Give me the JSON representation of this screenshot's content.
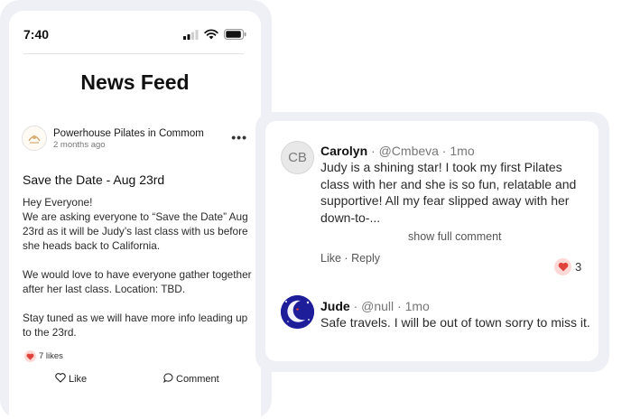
{
  "status_bar": {
    "time": "7:40"
  },
  "feed": {
    "title": "News Feed",
    "post": {
      "author": "Powerhouse Pilates in Commom",
      "time_ago": "2 months ago",
      "title": "Save the Date - Aug 23rd",
      "paragraphs": [
        "Hey Everyone!\nWe are asking everyone to “Save the Date” Aug 23rd as it will be Judy’s last class with us before she heads back to California.",
        "We would love to have everyone gather together after her last class. Location: TBD.",
        "Stay tuned as we will have more info leading up to the 23rd."
      ],
      "likes": "7 likes",
      "like_label": "Like",
      "comment_label": "Comment"
    }
  },
  "comments": [
    {
      "initials": "CB",
      "name": "Carolyn",
      "handle": "@Cmbeva",
      "time": "1mo",
      "text": "Judy is a shining star! I took my first Pilates class with her and she is so fun, relatable and supportive! All my fear slipped away with her down-to-...",
      "show_full": "show full comment",
      "like_label": "Like",
      "reply_label": "Reply",
      "reaction_count": "3"
    },
    {
      "name": "Jude",
      "handle": "@null",
      "time": "1mo",
      "text": "Safe travels. I will be out of town sorry to miss it."
    }
  ],
  "colors": {
    "heart": "#e0413b",
    "heart_bg": "#ffd9d6",
    "card_frame": "#eef0f6",
    "avatar_blue": "#1e1e9a"
  },
  "icons": [
    "signal-icon",
    "wifi-icon",
    "battery-icon",
    "more-options-icon",
    "heart-icon",
    "like-outline-icon",
    "comment-bubble-icon"
  ]
}
